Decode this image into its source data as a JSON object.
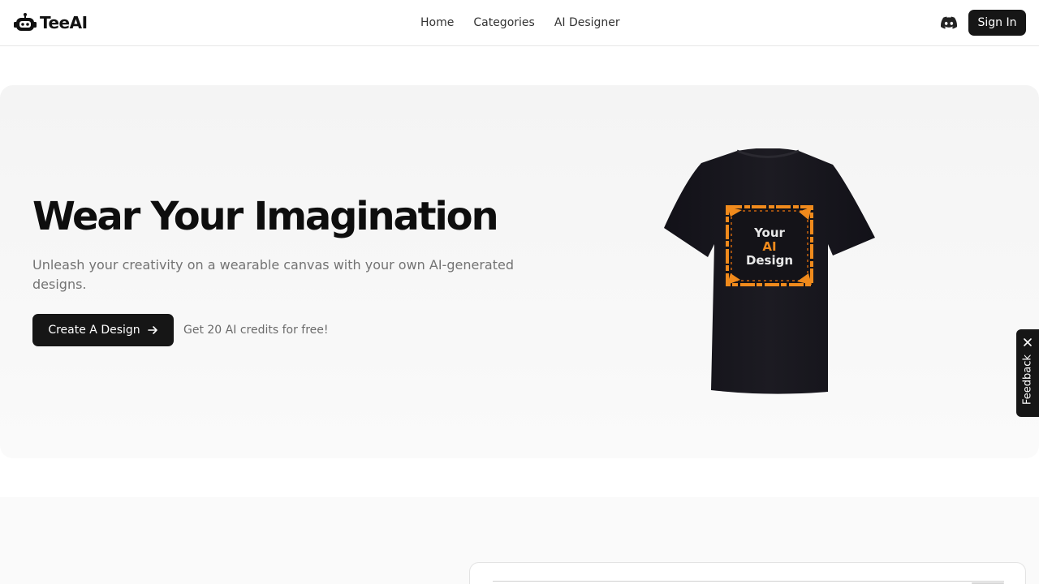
{
  "nav": {
    "logo_text": "TeeAI",
    "links": [
      {
        "label": "Home"
      },
      {
        "label": "Categories"
      },
      {
        "label": "AI Designer"
      }
    ],
    "discord_icon": "discord-icon",
    "signin_label": "Sign In"
  },
  "hero": {
    "headline": "Wear Your Imagination",
    "subtitle": "Unleash your creativity on a wearable canvas with your own AI-generated designs.",
    "cta_label": "Create A Design",
    "cta_icon": "arrow-right-icon",
    "cta_note": "Get 20 AI credits for free!",
    "shirt_print": {
      "line1": "Your",
      "line2": "AI",
      "line3": "Design"
    }
  },
  "feedback": {
    "label": "Feedback",
    "icon": "close-icon"
  },
  "colors": {
    "primary": "#161616",
    "accent_orange": "#f08a1c",
    "hero_bg": "#f4f4f4",
    "muted_text": "#737373"
  }
}
